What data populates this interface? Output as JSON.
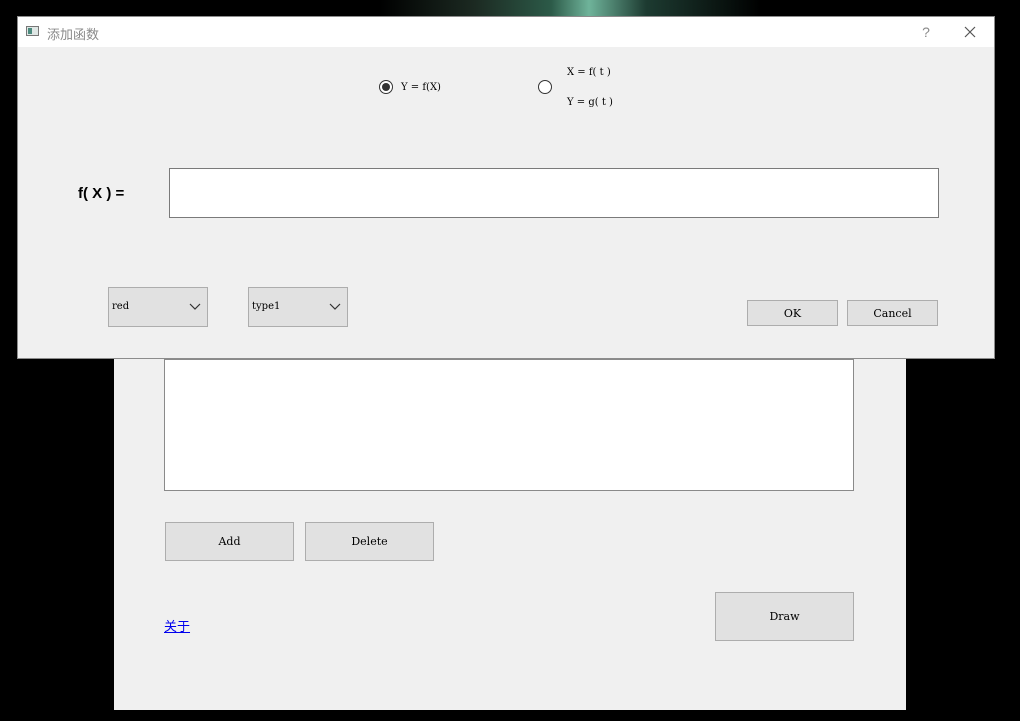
{
  "main_window": {
    "add_label": "Add",
    "delete_label": "Delete",
    "draw_label": "Draw",
    "about_link": "关于"
  },
  "dialog": {
    "title": "添加函数",
    "help": "?",
    "mode_options": {
      "explicit_label": "Y = f(X)",
      "param_x_label": "X = f( t )",
      "param_y_label": "Y = g( t )",
      "selected": "explicit"
    },
    "fx_label": "f( X ) =",
    "fx_value": "",
    "color_select": "red",
    "type_select": "type1",
    "ok_label": "OK",
    "cancel_label": "Cancel"
  }
}
